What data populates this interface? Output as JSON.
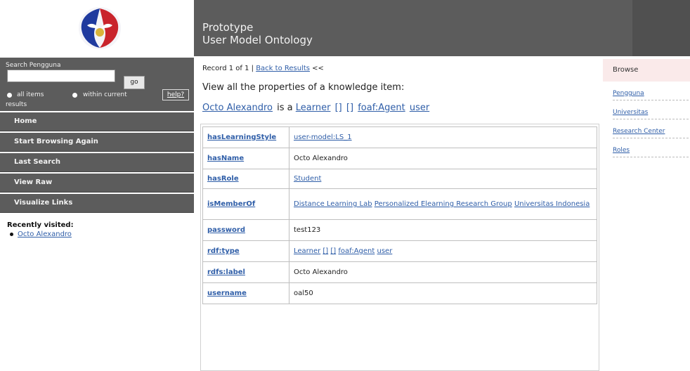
{
  "header": {
    "title_line1": "Prototype",
    "title_line2": "User Model Ontology"
  },
  "search": {
    "label": "Search Pengguna",
    "value": "",
    "go_label": "go",
    "all_items_label": "all items",
    "within_label": "within current",
    "results_label": "results",
    "help_label": "help?"
  },
  "nav": {
    "home": "Home",
    "start_browsing": "Start Browsing Again",
    "last_search": "Last Search",
    "view_raw": "View Raw",
    "visualize_links": "Visualize Links"
  },
  "recent": {
    "heading": "Recently visited:",
    "items": [
      "Octo Alexandro"
    ]
  },
  "record": {
    "text": "Record 1 of 1 |",
    "back_link": "Back to Results",
    "suffix": "<<"
  },
  "intro": "View all the properties of a knowledge item:",
  "summary": {
    "subject": "Octo Alexandro",
    "is_a": "is a",
    "types": [
      "Learner",
      "[]",
      "[]",
      "foaf:Agent",
      "user"
    ]
  },
  "properties": [
    {
      "key": "hasLearningStyle",
      "values": [
        "user-model:LS_1"
      ],
      "link": true
    },
    {
      "key": "hasName",
      "values": [
        "Octo Alexandro"
      ],
      "link": false
    },
    {
      "key": "hasRole",
      "values": [
        "Student"
      ],
      "link": true
    },
    {
      "key": "isMemberOf",
      "values": [
        "Distance Learning Lab",
        "Personalized Elearning Research Group",
        "Universitas Indonesia"
      ],
      "link": true
    },
    {
      "key": "password",
      "values": [
        "test123"
      ],
      "link": false
    },
    {
      "key": "rdf:type",
      "values": [
        "Learner",
        "[]",
        "[]",
        "foaf:Agent",
        "user"
      ],
      "link": true
    },
    {
      "key": "rdfs:label",
      "values": [
        "Octo Alexandro"
      ],
      "link": false
    },
    {
      "key": "username",
      "values": [
        "oal50"
      ],
      "link": false
    }
  ],
  "browse": {
    "title": "Browse",
    "items": [
      "Pengguna",
      "Universitas",
      "Research Center",
      "Roles"
    ]
  }
}
